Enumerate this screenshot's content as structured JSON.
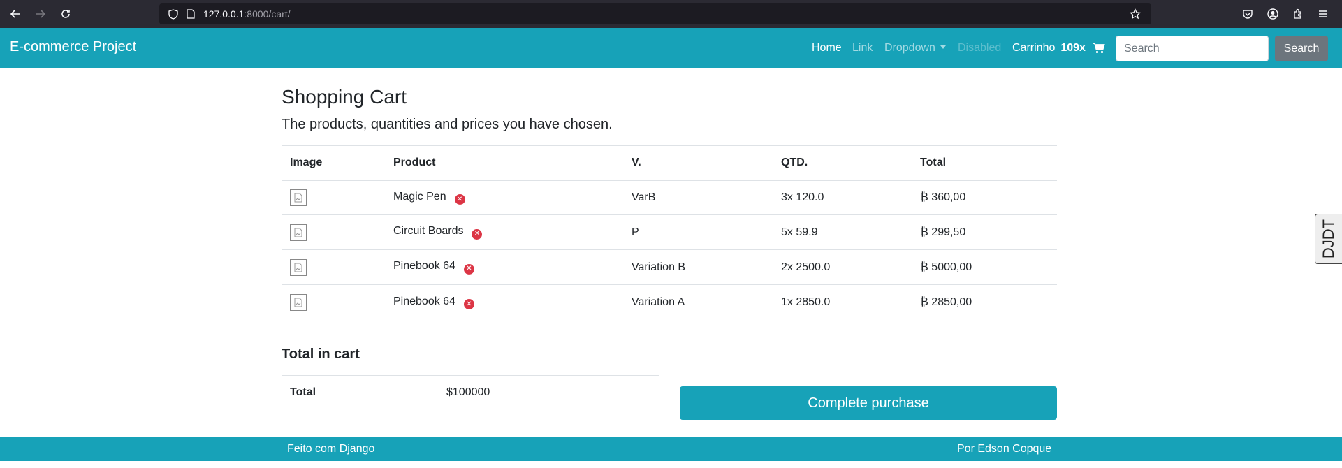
{
  "browser": {
    "url_host": "127.0.0.1",
    "url_path": ":8000/cart/"
  },
  "navbar": {
    "brand": "E-commerce Project",
    "links": [
      {
        "label": "Home"
      },
      {
        "label": "Link"
      },
      {
        "label": "Dropdown"
      },
      {
        "label": "Disabled"
      }
    ],
    "cart_label": "Carrinho",
    "cart_count": "109x",
    "search_placeholder": "Search",
    "search_button": "Search"
  },
  "page": {
    "title": "Shopping Cart",
    "lead": "The products, quantities and prices you have chosen."
  },
  "table": {
    "headers": [
      "Image",
      "Product",
      "V.",
      "QTD.",
      "Total"
    ],
    "rows": [
      {
        "product": "Magic Pen",
        "variation": "VarB",
        "qty": "3x 120.0",
        "total": "₿ 360,00"
      },
      {
        "product": "Circuit Boards",
        "variation": "P",
        "qty": "5x 59.9",
        "total": "₿ 299,50"
      },
      {
        "product": "Pinebook 64",
        "variation": "Variation B",
        "qty": "2x 2500.0",
        "total": "₿ 5000,00"
      },
      {
        "product": "Pinebook 64",
        "variation": "Variation A",
        "qty": "1x 2850.0",
        "total": "₿ 2850,00"
      }
    ]
  },
  "summary": {
    "title": "Total in cart",
    "label": "Total",
    "value": "$100000",
    "complete_button": "Complete purchase"
  },
  "footer": {
    "left": "Feito com Django",
    "right": "Por Edson Copque"
  },
  "debug_toolbar": {
    "label": "DJDT"
  },
  "colors": {
    "accent": "#17a2b8",
    "remove": "#dc3545",
    "secondary": "#6c757d"
  }
}
